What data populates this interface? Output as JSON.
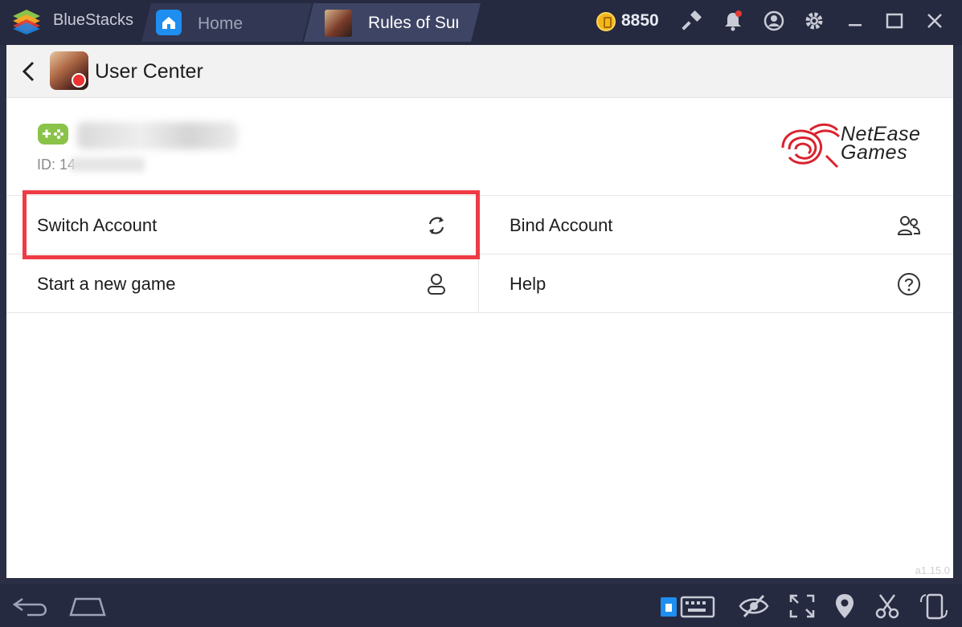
{
  "titlebar": {
    "app_name": "BlueStacks",
    "tabs": [
      {
        "label": "Home",
        "icon": "home-icon"
      },
      {
        "label": "Rules of Sur",
        "icon": "game-thumbnail"
      }
    ],
    "coins": "8850",
    "icons": [
      "coin-icon",
      "hammer-icon",
      "bell-icon",
      "account-icon",
      "gear-icon",
      "minimize-icon",
      "maximize-icon",
      "close-icon"
    ]
  },
  "header": {
    "title": "User Center"
  },
  "profile": {
    "id_label": "ID: 14"
  },
  "brand": {
    "line1": "NetEase",
    "line2": "Games"
  },
  "menu": {
    "switch_account": "Switch Account",
    "bind_account": "Bind Account",
    "start_new_game": "Start a new game",
    "help": "Help"
  },
  "version": "a1.15.0",
  "colors": {
    "titlebar_bg": "#262a40",
    "highlight": "#ee3b46",
    "gamepad": "#8bc34a",
    "netease_red": "#d9232e"
  },
  "bottombar": {
    "icons": [
      "back-icon",
      "home-icon",
      "keyboard-icon",
      "eye-icon",
      "fullscreen-icon",
      "location-icon",
      "scissors-icon",
      "rotate-icon"
    ]
  }
}
